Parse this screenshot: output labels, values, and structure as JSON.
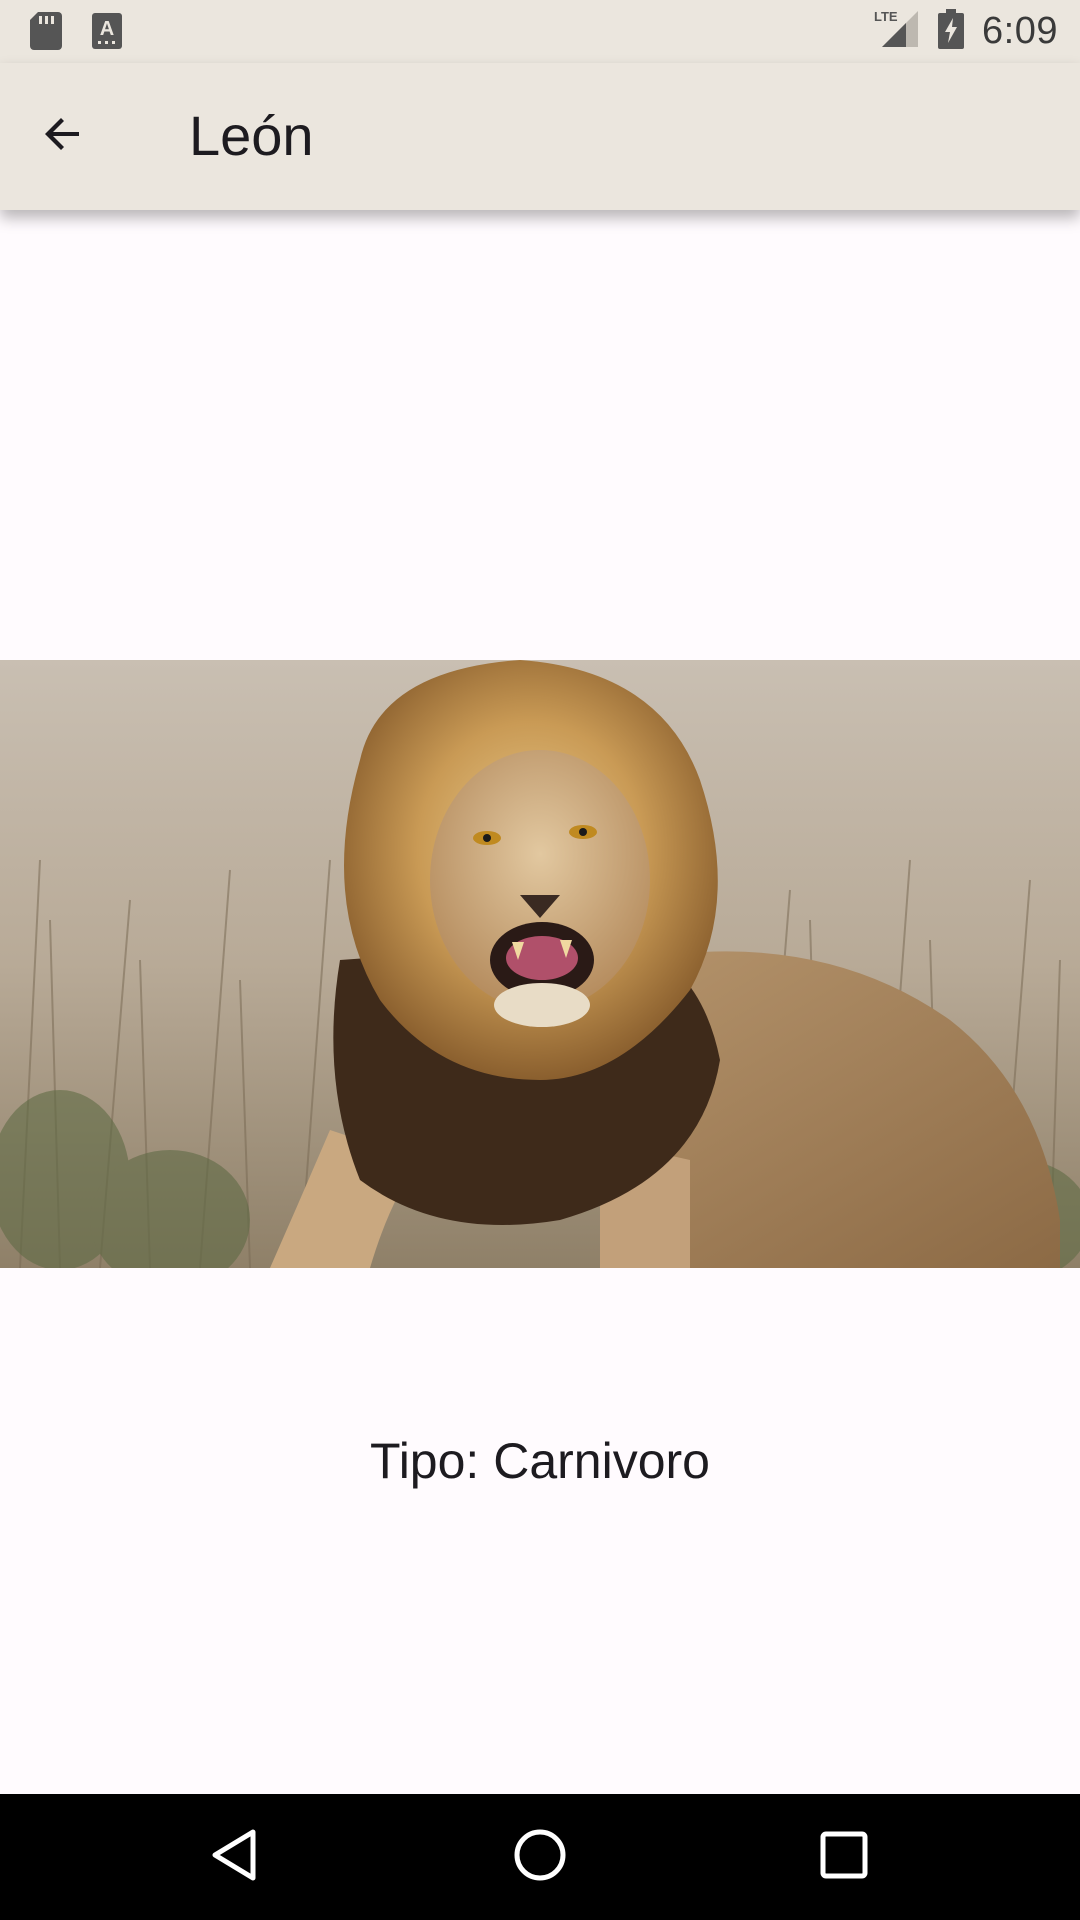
{
  "status_bar": {
    "time": "6:09",
    "network": "LTE",
    "left_icons": [
      "sd-card-icon",
      "keyboard-a-icon"
    ],
    "right_icons": [
      "lte-signal-icon",
      "battery-charging-icon"
    ]
  },
  "app_bar": {
    "title": "León",
    "back_icon": "arrow-back-icon"
  },
  "content": {
    "image_subject": "lion",
    "type_text": "Tipo: Carnivoro"
  },
  "nav_bar": {
    "icons": [
      "back-triangle-icon",
      "home-circle-icon",
      "recents-square-icon"
    ]
  },
  "colors": {
    "app_bar_bg": "#ebe6de",
    "background": "#fffbfe",
    "text": "#1d1b20",
    "nav_bg": "#000000"
  }
}
